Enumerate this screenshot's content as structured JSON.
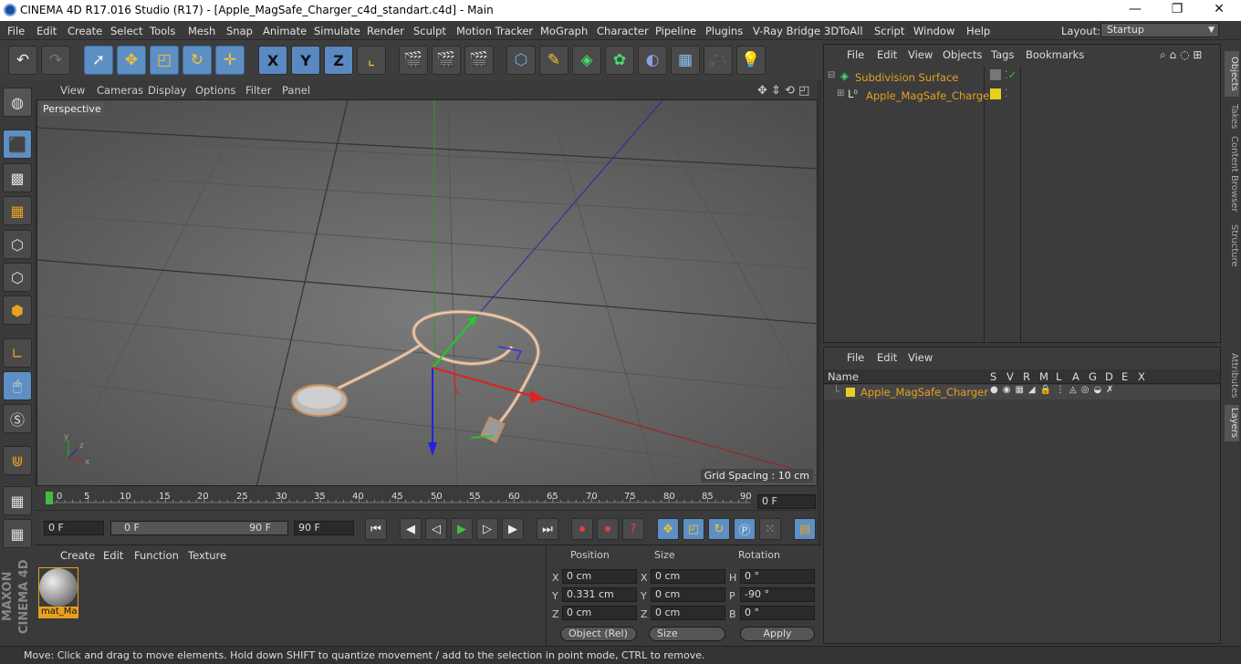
{
  "window": {
    "title": "CINEMA 4D R17.016 Studio (R17) - [Apple_MagSafe_Charger_c4d_standart.c4d] - Main",
    "minimize": "—",
    "maximize": "❐",
    "close": "✕"
  },
  "menubar": {
    "items": [
      "File",
      "Edit",
      "Create",
      "Select",
      "Tools",
      "Mesh",
      "Snap",
      "Animate",
      "Simulate",
      "Render",
      "Sculpt",
      "Motion Tracker",
      "MoGraph",
      "Character",
      "Pipeline",
      "Plugins",
      "V-Ray Bridge",
      "3DToAll",
      "Script",
      "Window",
      "Help"
    ],
    "layout_label": "Layout:",
    "layout_value": "Startup"
  },
  "toolbar": {
    "axis_x": "X",
    "axis_y": "Y",
    "axis_z": "Z"
  },
  "viewport_menu": {
    "items": [
      "View",
      "Cameras",
      "Display",
      "Options",
      "Filter",
      "Panel"
    ]
  },
  "viewport": {
    "label": "Perspective",
    "grid_spacing": "Grid Spacing : 10 cm"
  },
  "timeline": {
    "ticks": [
      "0",
      "5",
      "10",
      "15",
      "20",
      "25",
      "30",
      "35",
      "40",
      "45",
      "50",
      "55",
      "60",
      "65",
      "70",
      "75",
      "80",
      "85",
      "90"
    ],
    "current_frame": "0 F"
  },
  "transport": {
    "start": "0 F",
    "range_start": "0 F",
    "range_end": "90 F",
    "end": "90 F"
  },
  "material_panel": {
    "menu": [
      "Create",
      "Edit",
      "Function",
      "Texture"
    ],
    "material_name": "mat_Ma"
  },
  "coords": {
    "headers": {
      "position": "Position",
      "size": "Size",
      "rotation": "Rotation"
    },
    "position": {
      "x": "0 cm",
      "y": "0.331 cm",
      "z": "0 cm"
    },
    "size": {
      "x": "0 cm",
      "y": "0 cm",
      "z": "0 cm"
    },
    "rotation": {
      "h": "0 °",
      "p": "-90 °",
      "b": "0 °"
    },
    "labels": {
      "x": "X",
      "y": "Y",
      "z": "Z",
      "h": "H",
      "p": "P",
      "b": "B"
    },
    "mode": "Object (Rel)",
    "size_mode": "Size",
    "apply": "Apply"
  },
  "objects_panel": {
    "menu": [
      "File",
      "Edit",
      "View",
      "Objects",
      "Tags",
      "Bookmarks"
    ],
    "items": [
      {
        "name": "Subdivision Surface",
        "color": "#e8a020"
      },
      {
        "name": "Apple_MagSafe_Charger",
        "color": "#e8a020"
      }
    ],
    "tabs": [
      "Objects",
      "Takes",
      "Content Browser",
      "Structure"
    ]
  },
  "layers_panel": {
    "menu": [
      "File",
      "Edit",
      "View"
    ],
    "columns": [
      "Name",
      "S",
      "V",
      "R",
      "M",
      "L",
      "A",
      "G",
      "D",
      "E",
      "X"
    ],
    "row": "Apple_MagSafe_Charger",
    "tabs": [
      "Attributes",
      "Layers"
    ]
  },
  "status": "Move: Click and drag to move elements. Hold down SHIFT to quantize movement / add to the selection in point mode, CTRL to remove.",
  "logo": "MAXON CINEMA 4D",
  "colors": {
    "accent": "#5d8fc4",
    "highlight": "#e8a020",
    "viewport_bg": "#636363"
  }
}
